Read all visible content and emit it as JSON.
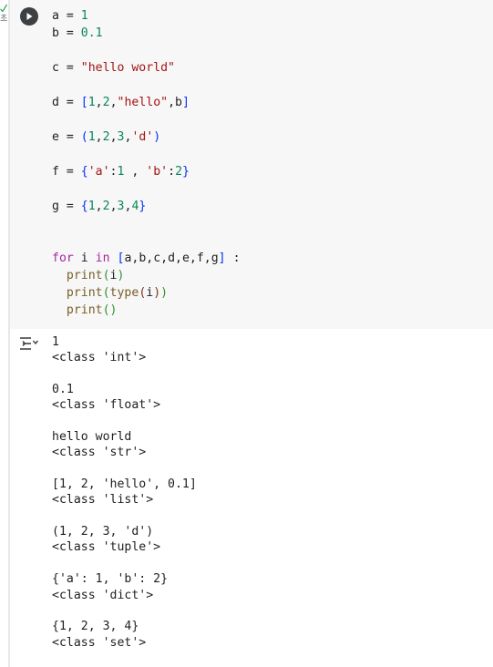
{
  "gutter": {
    "status_char": "초"
  },
  "code_lines": [
    [
      [
        "a = ",
        ""
      ],
      [
        "1",
        "num"
      ]
    ],
    [
      [
        "b = ",
        ""
      ],
      [
        "0.1",
        "num"
      ]
    ],
    [],
    [
      [
        "c = ",
        ""
      ],
      [
        "\"hello world\"",
        "str"
      ]
    ],
    [],
    [
      [
        "d = ",
        ""
      ],
      [
        "[",
        "bkt1"
      ],
      [
        "1",
        "num"
      ],
      [
        ",",
        ""
      ],
      [
        "2",
        "num"
      ],
      [
        ",",
        ""
      ],
      [
        "\"hello\"",
        "str"
      ],
      [
        ",b",
        ""
      ],
      [
        "]",
        "bkt1"
      ]
    ],
    [],
    [
      [
        "e = ",
        ""
      ],
      [
        "(",
        "bkt1"
      ],
      [
        "1",
        "num"
      ],
      [
        ",",
        ""
      ],
      [
        "2",
        "num"
      ],
      [
        ",",
        ""
      ],
      [
        "3",
        "num"
      ],
      [
        ",",
        ""
      ],
      [
        "'d'",
        "str"
      ],
      [
        ")",
        "bkt1"
      ]
    ],
    [],
    [
      [
        "f = ",
        ""
      ],
      [
        "{",
        "bkt1"
      ],
      [
        "'a'",
        "str"
      ],
      [
        ":",
        ""
      ],
      [
        "1",
        "num"
      ],
      [
        " , ",
        ""
      ],
      [
        "'b'",
        "str"
      ],
      [
        ":",
        ""
      ],
      [
        "2",
        "num"
      ],
      [
        "}",
        "bkt1"
      ]
    ],
    [],
    [
      [
        "g = ",
        ""
      ],
      [
        "{",
        "bkt1"
      ],
      [
        "1",
        "num"
      ],
      [
        ",",
        ""
      ],
      [
        "2",
        "num"
      ],
      [
        ",",
        ""
      ],
      [
        "3",
        "num"
      ],
      [
        ",",
        ""
      ],
      [
        "4",
        "num"
      ],
      [
        "}",
        "bkt1"
      ]
    ],
    [],
    [],
    [
      [
        "for",
        "kw"
      ],
      [
        " i ",
        ""
      ],
      [
        "in",
        "kw"
      ],
      [
        " ",
        ""
      ],
      [
        "[",
        "bkt1"
      ],
      [
        "a,b,c,d,e,f,g",
        ""
      ],
      [
        "]",
        "bkt1"
      ],
      [
        " :",
        ""
      ]
    ],
    [
      [
        "  ",
        ""
      ],
      [
        "print",
        "fn"
      ],
      [
        "(",
        "bkt2"
      ],
      [
        "i",
        ""
      ],
      [
        ")",
        "bkt2"
      ]
    ],
    [
      [
        "  ",
        ""
      ],
      [
        "print",
        "fn"
      ],
      [
        "(",
        "bkt2"
      ],
      [
        "type",
        "fn"
      ],
      [
        "(",
        "bkt3"
      ],
      [
        "i",
        ""
      ],
      [
        ")",
        "bkt3"
      ],
      [
        ")",
        "bkt2"
      ]
    ],
    [
      [
        "  ",
        ""
      ],
      [
        "print",
        "fn"
      ],
      [
        "()",
        "bkt2"
      ]
    ]
  ],
  "output_lines": [
    "1",
    "<class 'int'>",
    "",
    "0.1",
    "<class 'float'>",
    "",
    "hello world",
    "<class 'str'>",
    "",
    "[1, 2, 'hello', 0.1]",
    "<class 'list'>",
    "",
    "(1, 2, 3, 'd')",
    "<class 'tuple'>",
    "",
    "{'a': 1, 'b': 2}",
    "<class 'dict'>",
    "",
    "{1, 2, 3, 4}",
    "<class 'set'>"
  ]
}
